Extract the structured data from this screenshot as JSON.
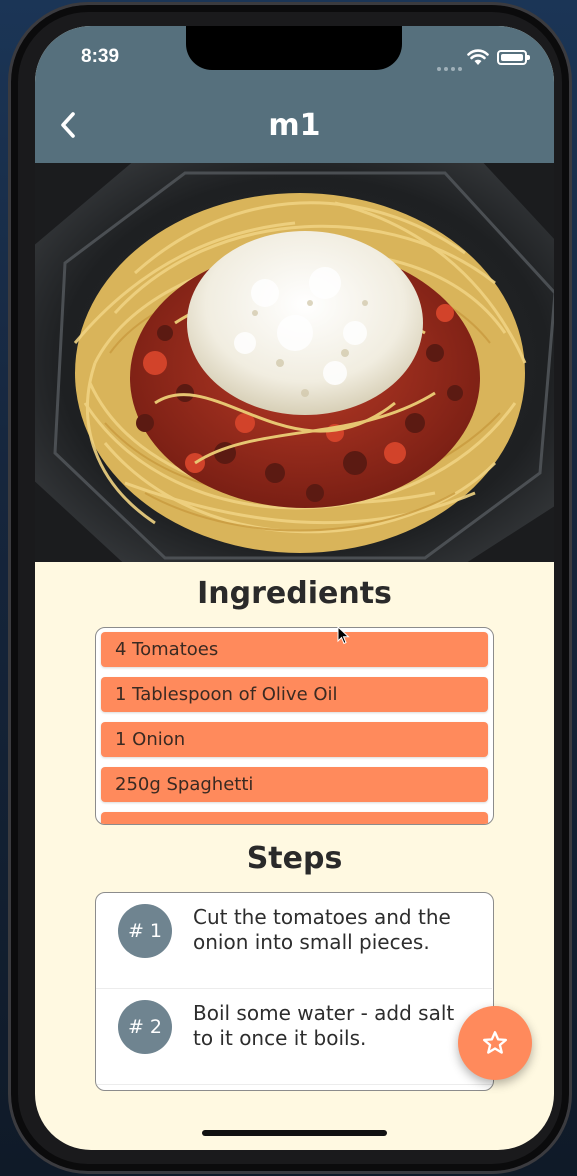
{
  "status_bar": {
    "time": "8:39"
  },
  "app_bar": {
    "title": "m1"
  },
  "ingredients": {
    "title": "Ingredients",
    "items": [
      "4 Tomatoes",
      "1 Tablespoon of Olive Oil",
      "1 Onion",
      "250g Spaghetti",
      ""
    ]
  },
  "steps": {
    "title": "Steps",
    "items": [
      {
        "number": "# 1",
        "text": "Cut the tomatoes and the onion into small pieces."
      },
      {
        "number": "# 2",
        "text": "Boil some water - add salt to it once it boils."
      }
    ]
  },
  "colors": {
    "app_bar": "#56707d",
    "background": "#fff9e1",
    "accent": "#ff8a5c",
    "step_avatar": "#6f8490"
  },
  "icons": {
    "back": "chevron-left-icon",
    "favorite": "star-outline-icon",
    "wifi": "wifi-icon",
    "battery": "battery-icon"
  }
}
